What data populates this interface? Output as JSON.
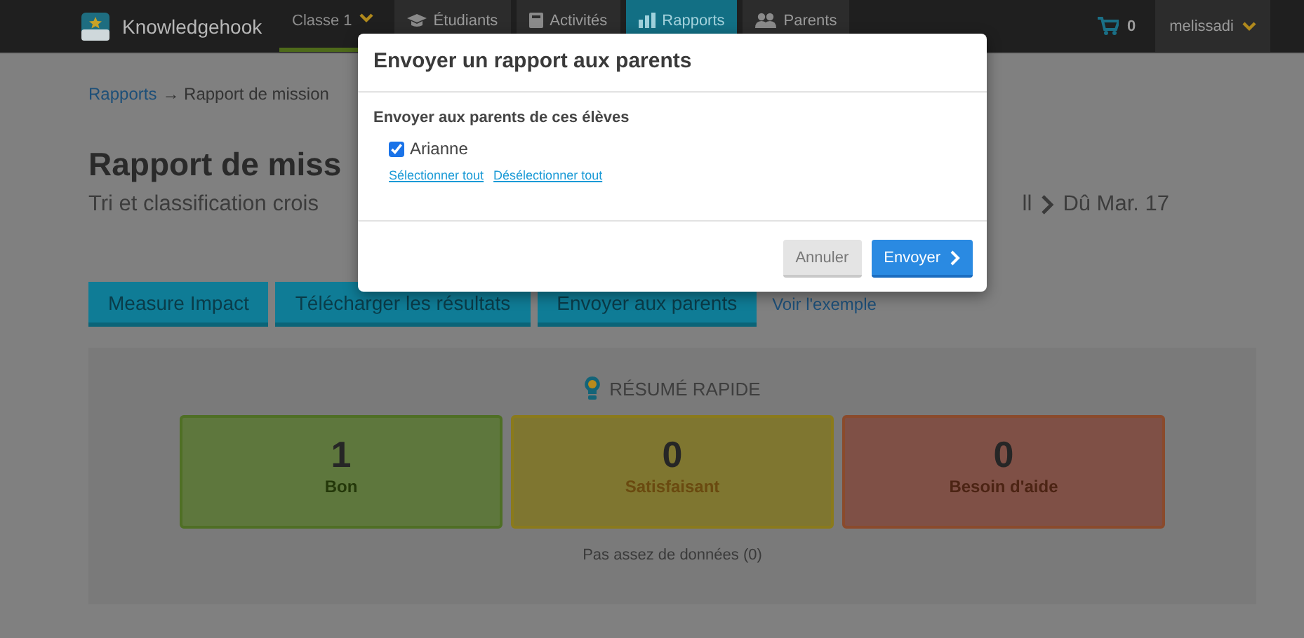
{
  "nav": {
    "brand": "Knowledgehook",
    "items": [
      {
        "label": "Classe 1",
        "kind": "class",
        "selected": true
      },
      {
        "label": "Étudiants",
        "kind": "students",
        "selected": false
      },
      {
        "label": "Activités",
        "kind": "activities",
        "selected": false
      },
      {
        "label": "Rapports",
        "kind": "reports",
        "selected": true
      },
      {
        "label": "Parents",
        "kind": "parents",
        "selected": false
      }
    ],
    "cart_count": "0",
    "user": "melissadi"
  },
  "breadcrumb": {
    "link": "Rapports",
    "rest": "→ Rapport de mission"
  },
  "title": "Rapport de miss",
  "subtitle": {
    "left": "Tri et classification crois",
    "right_start": "ll",
    "right_end": "Dû Mar. 17"
  },
  "actions": {
    "buttons": [
      "Measure Impact",
      "Télécharger les résultats",
      "Envoyer aux parents"
    ],
    "link": "Voir l'exemple"
  },
  "summary": {
    "title": "RÉSUMÉ RAPIDE",
    "cards": [
      {
        "count": "1",
        "label": "Bon",
        "kind": "good"
      },
      {
        "count": "0",
        "label": "Satisfaisant",
        "kind": "ok"
      },
      {
        "count": "0",
        "label": "Besoin d'aide",
        "kind": "help"
      }
    ],
    "note": "Pas assez de données (0)"
  },
  "modal": {
    "title": "Envoyer un rapport aux parents",
    "section": "Envoyer aux parents de ces élèves",
    "students": [
      {
        "name": "Arianne",
        "checked": true
      }
    ],
    "links": [
      "Sélectionner tout",
      "Désélectionner tout"
    ],
    "buttons": [
      {
        "label": "Annuler",
        "kind": "secondary"
      },
      {
        "label": "Envoyer",
        "kind": "primary"
      }
    ]
  }
}
